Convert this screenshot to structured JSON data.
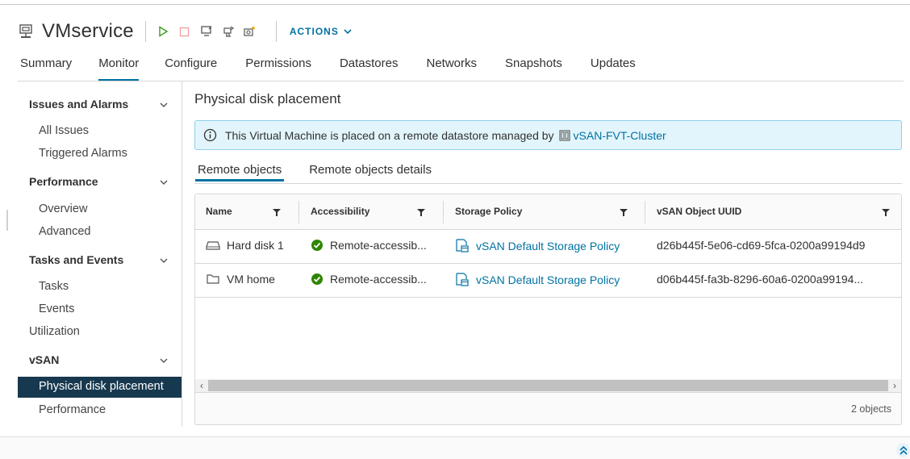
{
  "header": {
    "title": "VMservice",
    "actions_label": "ACTIONS",
    "toolbar_icons": [
      "power-on-icon",
      "power-off-icon",
      "console-icon",
      "migrate-icon",
      "snapshot-icon"
    ]
  },
  "tabs": [
    {
      "label": "Summary"
    },
    {
      "label": "Monitor",
      "active": true
    },
    {
      "label": "Configure"
    },
    {
      "label": "Permissions"
    },
    {
      "label": "Datastores"
    },
    {
      "label": "Networks"
    },
    {
      "label": "Snapshots"
    },
    {
      "label": "Updates"
    }
  ],
  "sidebar": {
    "issues": {
      "label": "Issues and Alarms",
      "items": [
        "All Issues",
        "Triggered Alarms"
      ]
    },
    "performance": {
      "label": "Performance",
      "items": [
        "Overview",
        "Advanced"
      ]
    },
    "tasks": {
      "label": "Tasks and Events",
      "items": [
        "Tasks",
        "Events"
      ]
    },
    "utilization": "Utilization",
    "vsan": {
      "label": "vSAN",
      "items": [
        "Physical disk placement",
        "Performance"
      ]
    }
  },
  "content": {
    "title": "Physical disk placement",
    "alert_text": "This Virtual Machine is placed on a remote datastore managed by",
    "alert_link": "vSAN-FVT-Cluster",
    "subtabs": [
      "Remote objects",
      "Remote objects details"
    ]
  },
  "grid": {
    "columns": [
      "Name",
      "Accessibility",
      "Storage Policy",
      "vSAN Object UUID"
    ],
    "rows": [
      {
        "name": "Hard disk 1",
        "accessibility": "Remote-accessib...",
        "policy": "vSAN Default Storage Policy",
        "uuid": "d26b445f-5e06-cd69-5fca-0200a99194d9"
      },
      {
        "name": "VM home",
        "accessibility": "Remote-accessib...",
        "policy": "vSAN Default Storage Policy",
        "uuid": "d06b445f-fa3b-8296-60a6-0200a99194..."
      }
    ],
    "footer": "2 objects"
  },
  "colors": {
    "accent": "#0072a3",
    "selected": "#17394f",
    "ok": "#2e8500",
    "info_bg": "#e3f5fc"
  }
}
